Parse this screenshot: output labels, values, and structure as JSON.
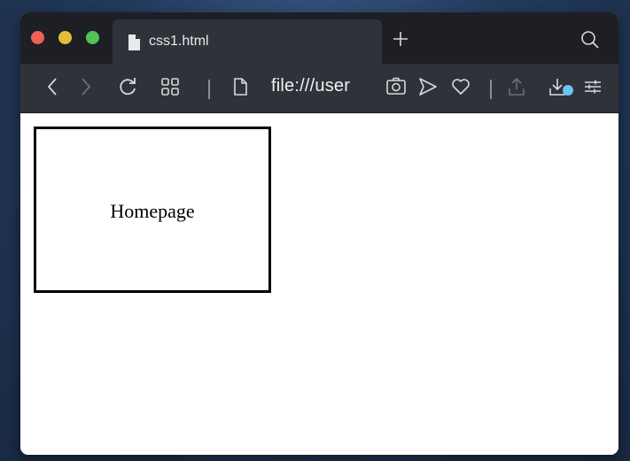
{
  "tab": {
    "title": "css1.html"
  },
  "address": {
    "url": "file:///user"
  },
  "page": {
    "box_text": "Homepage"
  },
  "icons": {
    "tab_doc": "document-icon",
    "new_tab": "plus-icon",
    "search": "search-icon",
    "back": "chevron-left-icon",
    "forward": "chevron-right-icon",
    "reload": "reload-icon",
    "speed_dial": "grid-icon",
    "page_icon": "page-icon",
    "snapshot": "camera-icon",
    "send": "send-icon",
    "bookmark": "heart-icon",
    "share": "share-icon",
    "downloads": "download-icon",
    "menu": "sliders-icon"
  },
  "colors": {
    "close": "#ee5f55",
    "minimize": "#e6bd3a",
    "maximize": "#52c255",
    "download_badge": "#6cc3f5"
  }
}
